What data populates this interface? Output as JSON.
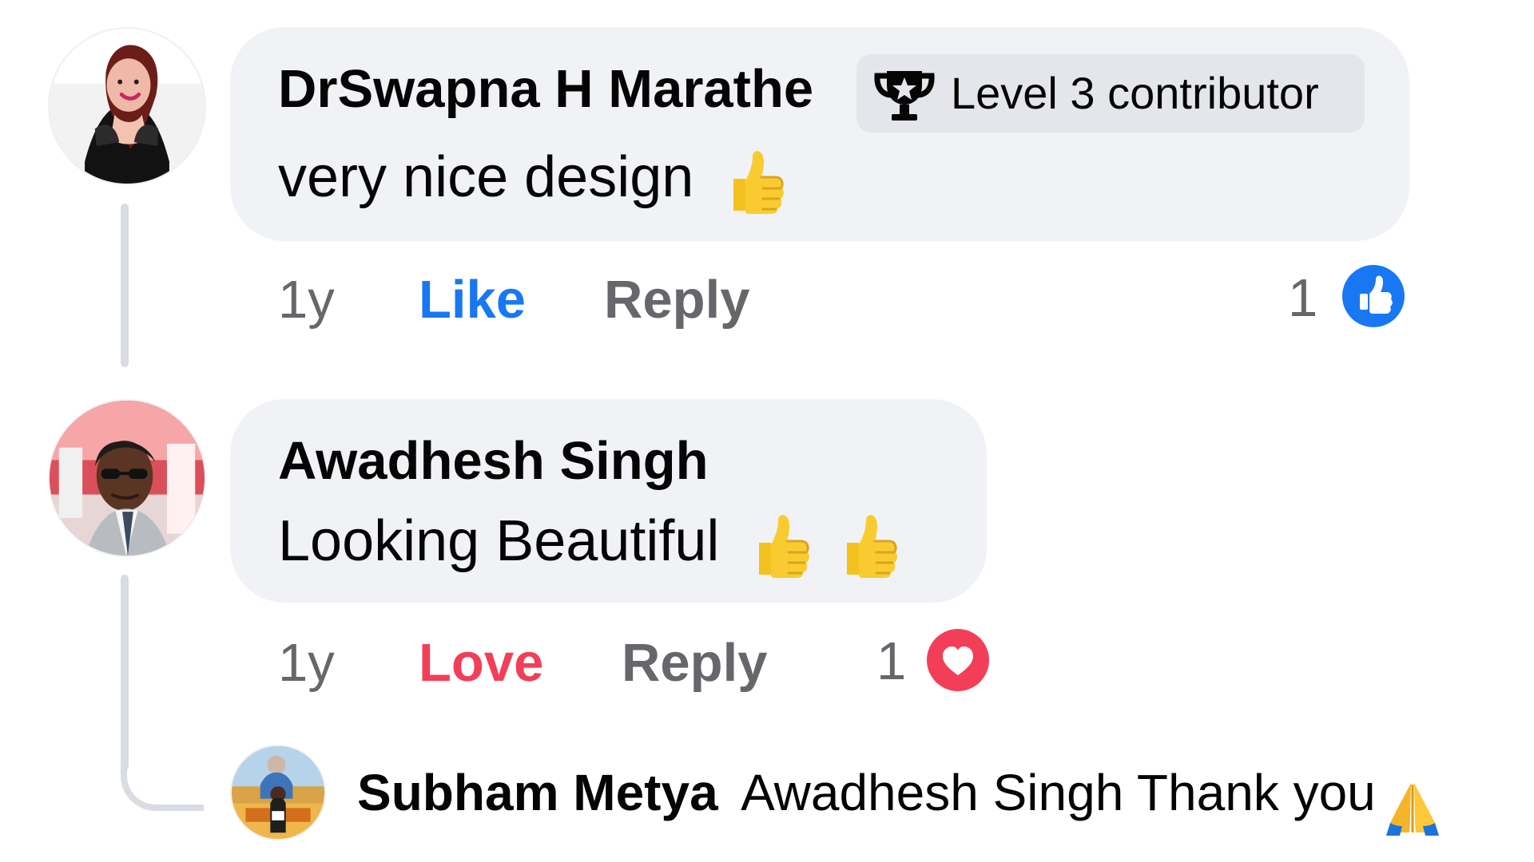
{
  "comments": [
    {
      "author": "DrSwapna H Marathe",
      "badge": "Level 3 contributor",
      "text": "very nice design",
      "emoji": [
        "thumbs-up"
      ],
      "time": "1y",
      "action": "Like",
      "reply": "Reply",
      "reaction_count": "1",
      "reaction_icon": "like-icon"
    },
    {
      "author": "Awadhesh Singh",
      "text": "Looking Beautiful",
      "emoji": [
        "thumbs-up",
        "thumbs-up"
      ],
      "time": "1y",
      "action": "Love",
      "reply": "Reply",
      "reaction_count": "1",
      "reaction_icon": "love-icon"
    }
  ],
  "reply": {
    "author": "Subham Metya",
    "text": "Awadhesh Singh Thank you",
    "emoji": [
      "folded-hands"
    ]
  },
  "colors": {
    "like": "#1877f2",
    "love": "#f33e58",
    "muted": "#65676b",
    "bubble": "#f0f2f5"
  }
}
